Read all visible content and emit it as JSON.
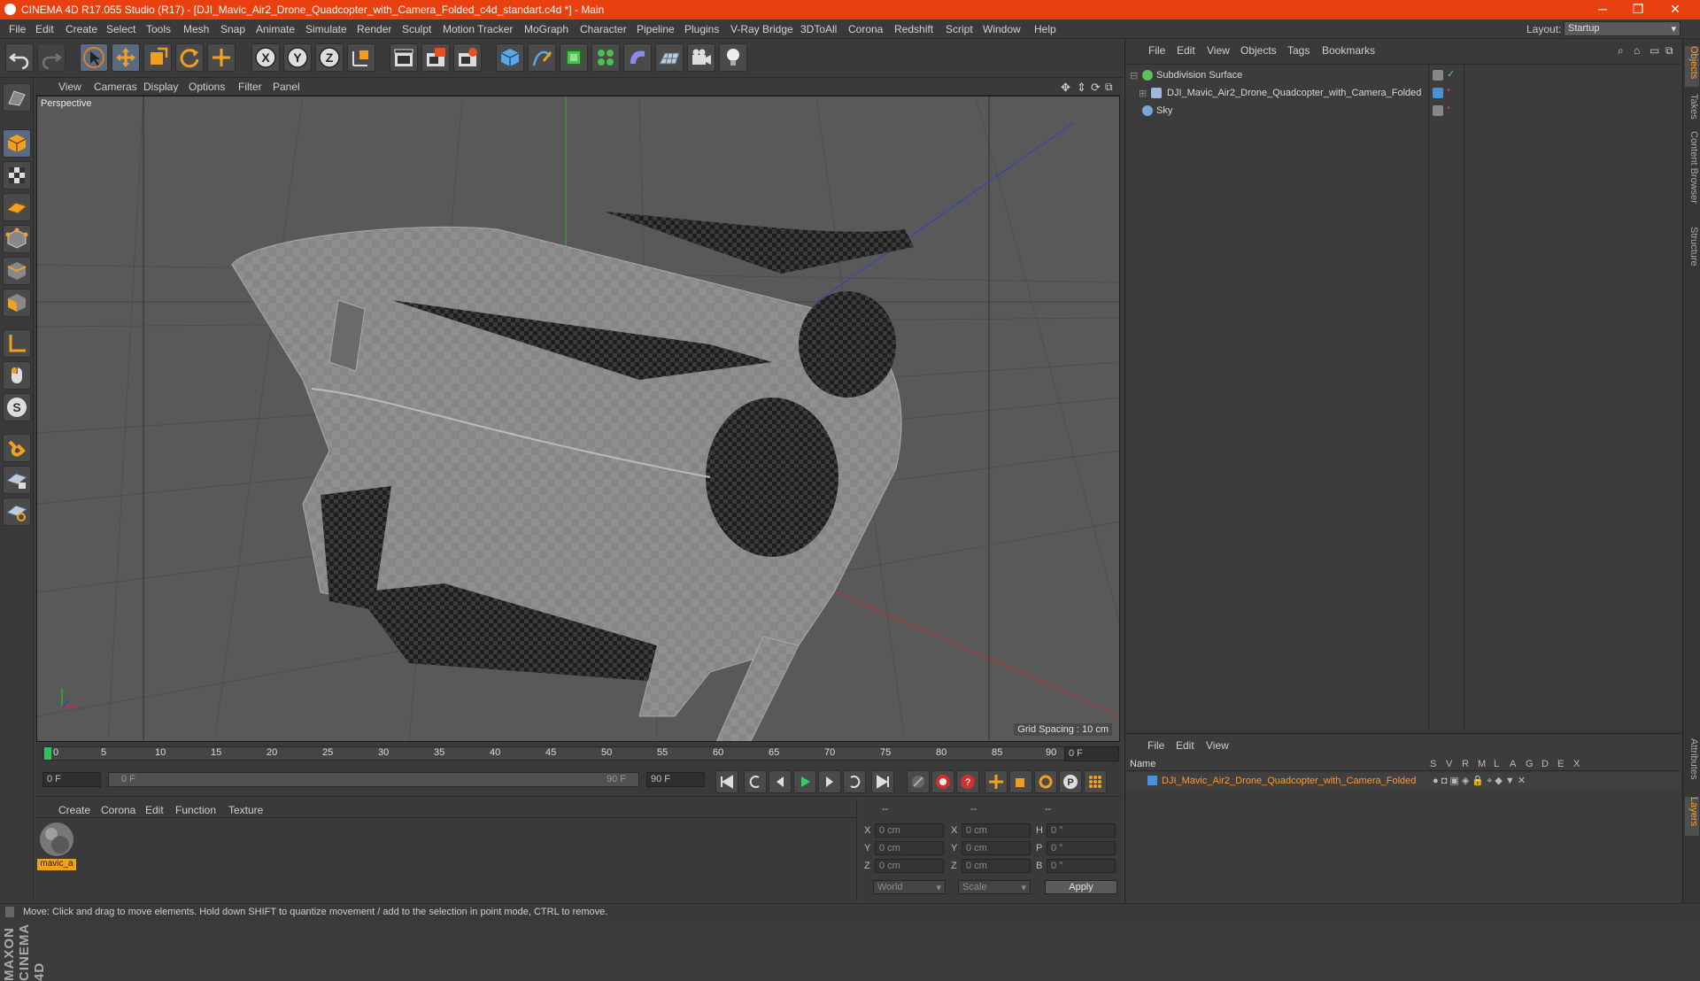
{
  "titlebar": {
    "title": "CINEMA 4D R17.055 Studio (R17) - [DJI_Mavic_Air2_Drone_Quadcopter_with_Camera_Folded_c4d_standart.c4d *] - Main",
    "minimize": "─",
    "maximize": "❐",
    "close": "✕"
  },
  "menu": [
    "File",
    "Edit",
    "Create",
    "Select",
    "Tools",
    "Mesh",
    "Snap",
    "Animate",
    "Simulate",
    "Render",
    "Sculpt",
    "Motion Tracker",
    "MoGraph",
    "Character",
    "Pipeline",
    "Plugins",
    "V-Ray Bridge",
    "3DToAll",
    "Corona",
    "Redshift",
    "Script",
    "Window",
    "Help"
  ],
  "layout": {
    "label": "Layout:",
    "value": "Startup"
  },
  "viewport": {
    "menu": [
      "View",
      "Cameras",
      "Display",
      "Options",
      "Filter",
      "Panel"
    ],
    "label": "Perspective",
    "grid_spacing": "Grid Spacing : 10 cm"
  },
  "timeline": {
    "ticks": [
      "0",
      "5",
      "10",
      "15",
      "20",
      "25",
      "30",
      "35",
      "40",
      "45",
      "50",
      "55",
      "60",
      "65",
      "70",
      "75",
      "80",
      "85",
      "90"
    ],
    "current_frame": "0 F",
    "start_frame": "0 F",
    "range_start": "0 F",
    "range_end": "90 F",
    "end_frame": "90 F"
  },
  "material": {
    "menu": [
      "Create",
      "Corona",
      "Edit",
      "Function",
      "Texture"
    ],
    "items": [
      {
        "name": "mavic_a"
      }
    ]
  },
  "coords": {
    "headers": [
      "--",
      "--",
      "--"
    ],
    "rows": [
      {
        "l1": "X",
        "v1": "0 cm",
        "l2": "X",
        "v2": "0 cm",
        "l3": "H",
        "v3": "0 °"
      },
      {
        "l1": "Y",
        "v1": "0 cm",
        "l2": "Y",
        "v2": "0 cm",
        "l3": "P",
        "v3": "0 °"
      },
      {
        "l1": "Z",
        "v1": "0 cm",
        "l2": "Z",
        "v2": "0 cm",
        "l3": "B",
        "v3": "0 °"
      }
    ],
    "world": "World",
    "scale": "Scale",
    "apply": "Apply"
  },
  "objects": {
    "menu": [
      "File",
      "Edit",
      "View",
      "Objects",
      "Tags",
      "Bookmarks"
    ],
    "items": [
      {
        "name": "Subdivision Surface",
        "color": "#5fbf5f"
      },
      {
        "name": "DJI_Mavic_Air2_Drone_Quadcopter_with_Camera_Folded",
        "color": "#9fb7d8"
      },
      {
        "name": "Sky",
        "color": "#7aa7d8"
      }
    ]
  },
  "layers": {
    "menu": [
      "File",
      "Edit",
      "View"
    ],
    "name_header": "Name",
    "columns": [
      "S",
      "V",
      "R",
      "M",
      "L",
      "A",
      "G",
      "D",
      "E",
      "X"
    ],
    "items": [
      {
        "name": "DJI_Mavic_Air2_Drone_Quadcopter_with_Camera_Folded",
        "color": "#4a90d9"
      }
    ]
  },
  "side_tabs": [
    "Objects",
    "Takes",
    "Content Browser",
    "Structure",
    "Attributes",
    "Layers"
  ],
  "status": "Move: Click and drag to move elements. Hold down SHIFT to quantize movement / add to the selection in point mode, CTRL to remove.",
  "colors": {
    "accent": "#e8400f",
    "selected_text": "#ff9a2a",
    "axis_x": "#c03030",
    "axis_y": "#30b030",
    "axis_z": "#3040c8"
  }
}
